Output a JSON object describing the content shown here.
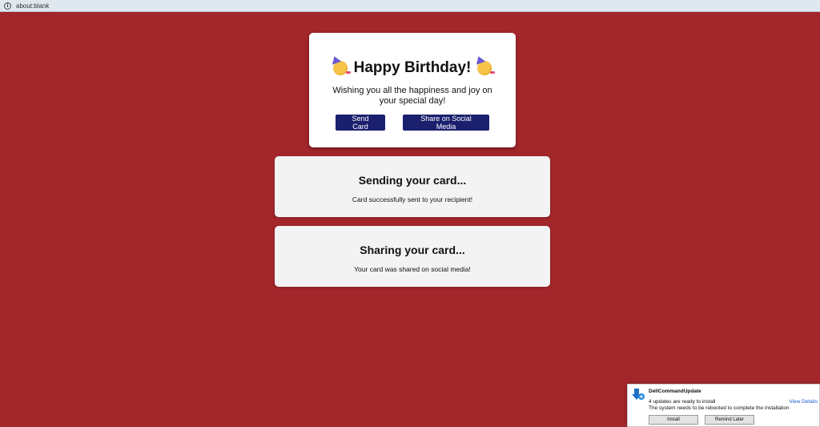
{
  "browser": {
    "address": "about:blank"
  },
  "birthday_card": {
    "title": "Happy Birthday!",
    "message": "Wishing you all the happiness and joy on your special day!",
    "send_button": "Send Card",
    "share_button": "Share on Social Media"
  },
  "sending_card": {
    "title": "Sending your card...",
    "status": "Card successfully sent to your recipient!"
  },
  "sharing_card": {
    "title": "Sharing your card...",
    "status": "Your card was shared on social media!"
  },
  "notification": {
    "app_name": "DellCommandUpdate",
    "line1": "4 updates are ready to install",
    "line2": "The system needs to be rebooted to complete the installation",
    "view_details": "View Details",
    "install_button": "Install",
    "remind_button": "Remind Later"
  },
  "colors": {
    "background": "#a3262a",
    "button": "#1a1f6e",
    "card": "#ffffff",
    "status_card": "#f3f3f3"
  },
  "icons": {
    "address_info": "info-icon",
    "party_emoji": "party-face-icon",
    "notification_app": "dell-command-update-icon"
  }
}
